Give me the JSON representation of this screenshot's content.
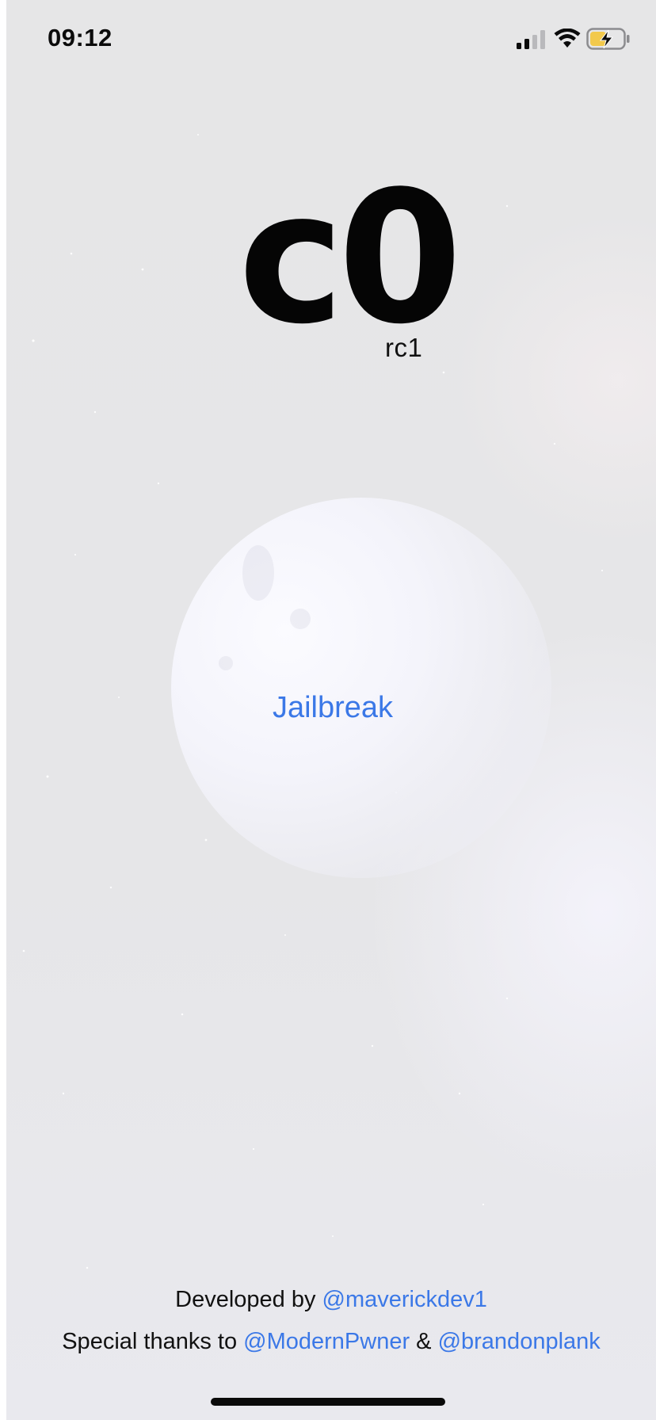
{
  "status_bar": {
    "time": "09:12",
    "icons": [
      "cellular-signal-icon",
      "wifi-icon",
      "battery-charging-icon"
    ],
    "battery_color": "#f2c94c"
  },
  "app": {
    "logo": "c0",
    "release": "rc1"
  },
  "main": {
    "jailbreak_label": "Jailbreak",
    "accent_color": "#3b78e7"
  },
  "credits": {
    "developed_by_prefix": "Developed by",
    "developer_handle": "@maverickdev1",
    "thanks_prefix": "Special thanks to",
    "thanks_handle_1": "@ModernPwner",
    "separator": "&",
    "thanks_handle_2": "@brandonplank"
  }
}
